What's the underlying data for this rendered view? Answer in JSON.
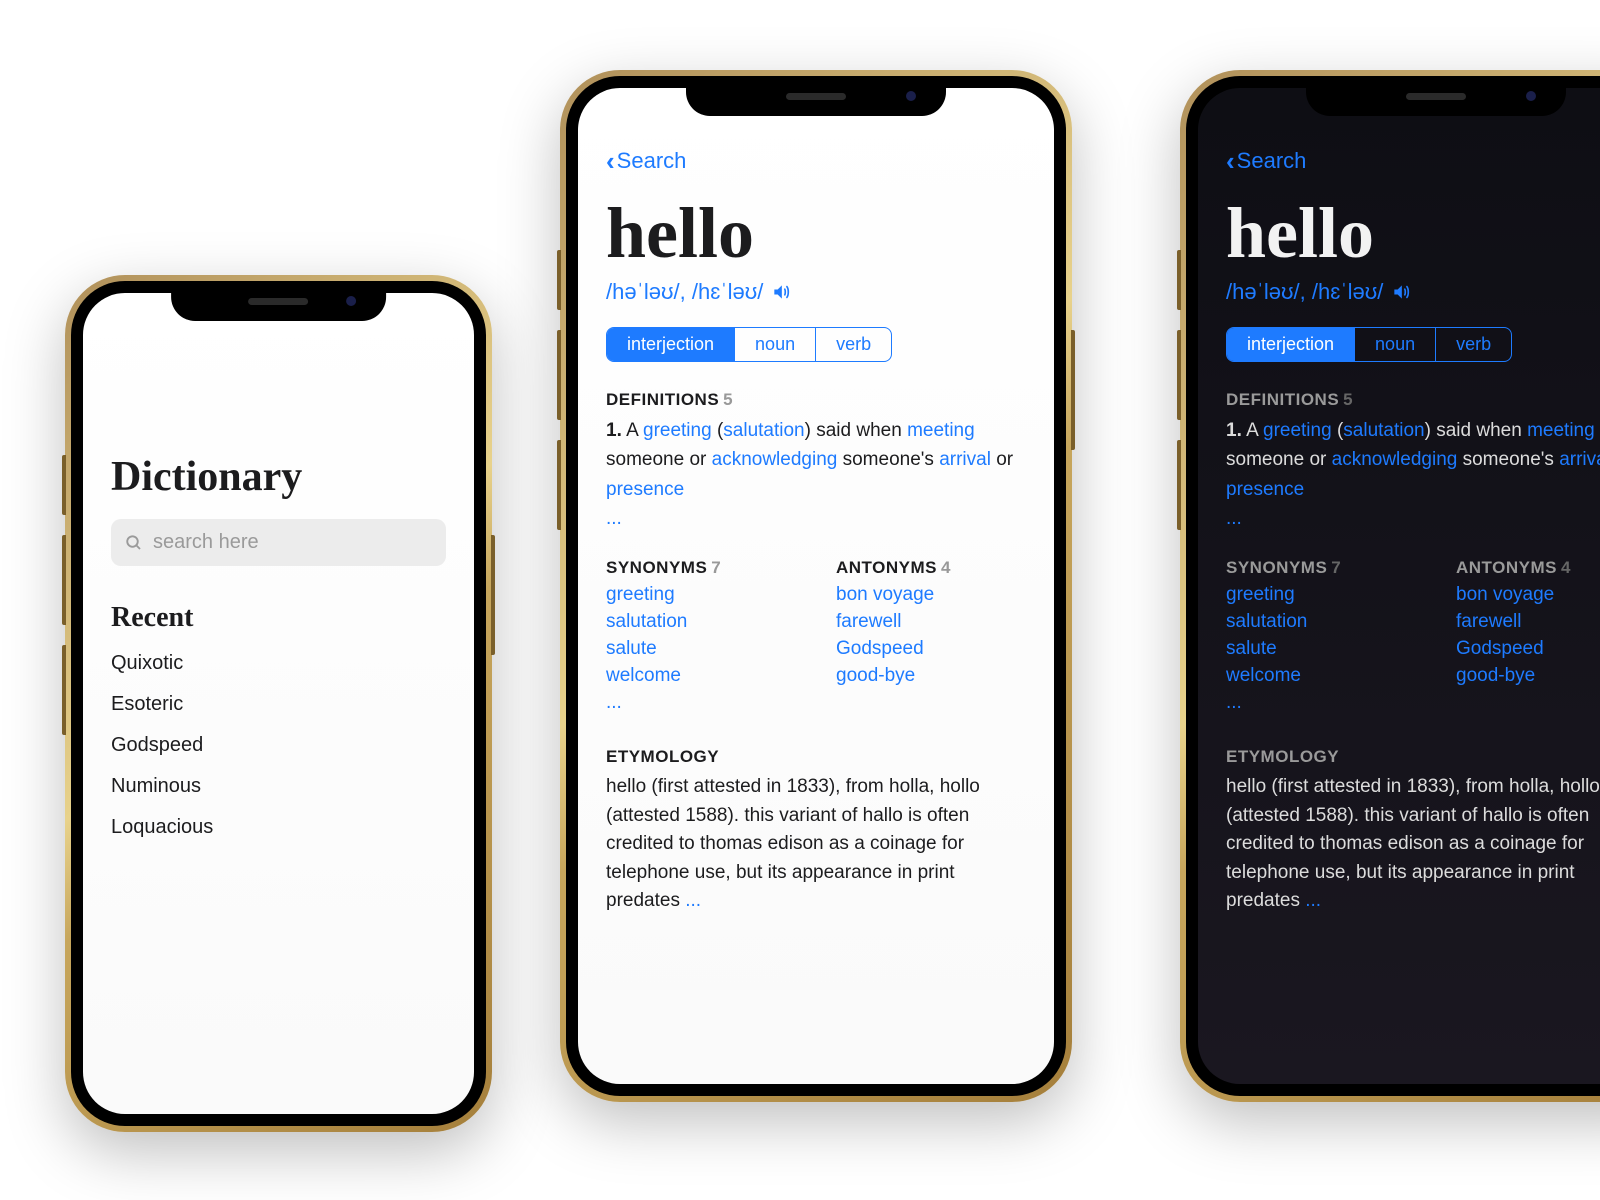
{
  "colors": {
    "accent": "#1e7bff"
  },
  "home": {
    "title": "Dictionary",
    "search_placeholder": "search here",
    "recent_heading": "Recent",
    "recent": [
      "Quixotic",
      "Esoteric",
      "Godspeed",
      "Numinous",
      "Loquacious"
    ]
  },
  "entry": {
    "back_label": "Search",
    "headword": "hello",
    "pronunciation": "/həˈləʊ/, /hɛˈləʊ/",
    "pos_tabs": [
      "interjection",
      "noun",
      "verb"
    ],
    "pos_active": "interjection",
    "definitions": {
      "heading": "DEFINITIONS",
      "count": "5",
      "item_num": "1.",
      "p_a": "A ",
      "link1": "greeting",
      "p_b": " (",
      "link2": "salutation",
      "p_c": ") said when ",
      "link3": "meeting",
      "p_d": " someone or ",
      "link4": "acknowledging",
      "p_e": " someone's ",
      "link5": "arrival",
      "p_f": " or ",
      "link6": "presence",
      "more": "..."
    },
    "synonyms": {
      "heading": "SYNONYMS",
      "count": "7",
      "items": [
        "greeting",
        "salutation",
        "salute",
        "welcome"
      ],
      "more": "..."
    },
    "antonyms": {
      "heading": "ANTONYMS",
      "count": "4",
      "items": [
        "bon voyage",
        "farewell",
        "Godspeed",
        "good-bye"
      ]
    },
    "etymology": {
      "heading": "ETYMOLOGY",
      "text": "hello (first attested in 1833), from holla, hollo (attested 1588). this variant of hallo is often credited to thomas edison as a coinage for telephone use, but its appearance in print predates ",
      "more": "..."
    }
  }
}
